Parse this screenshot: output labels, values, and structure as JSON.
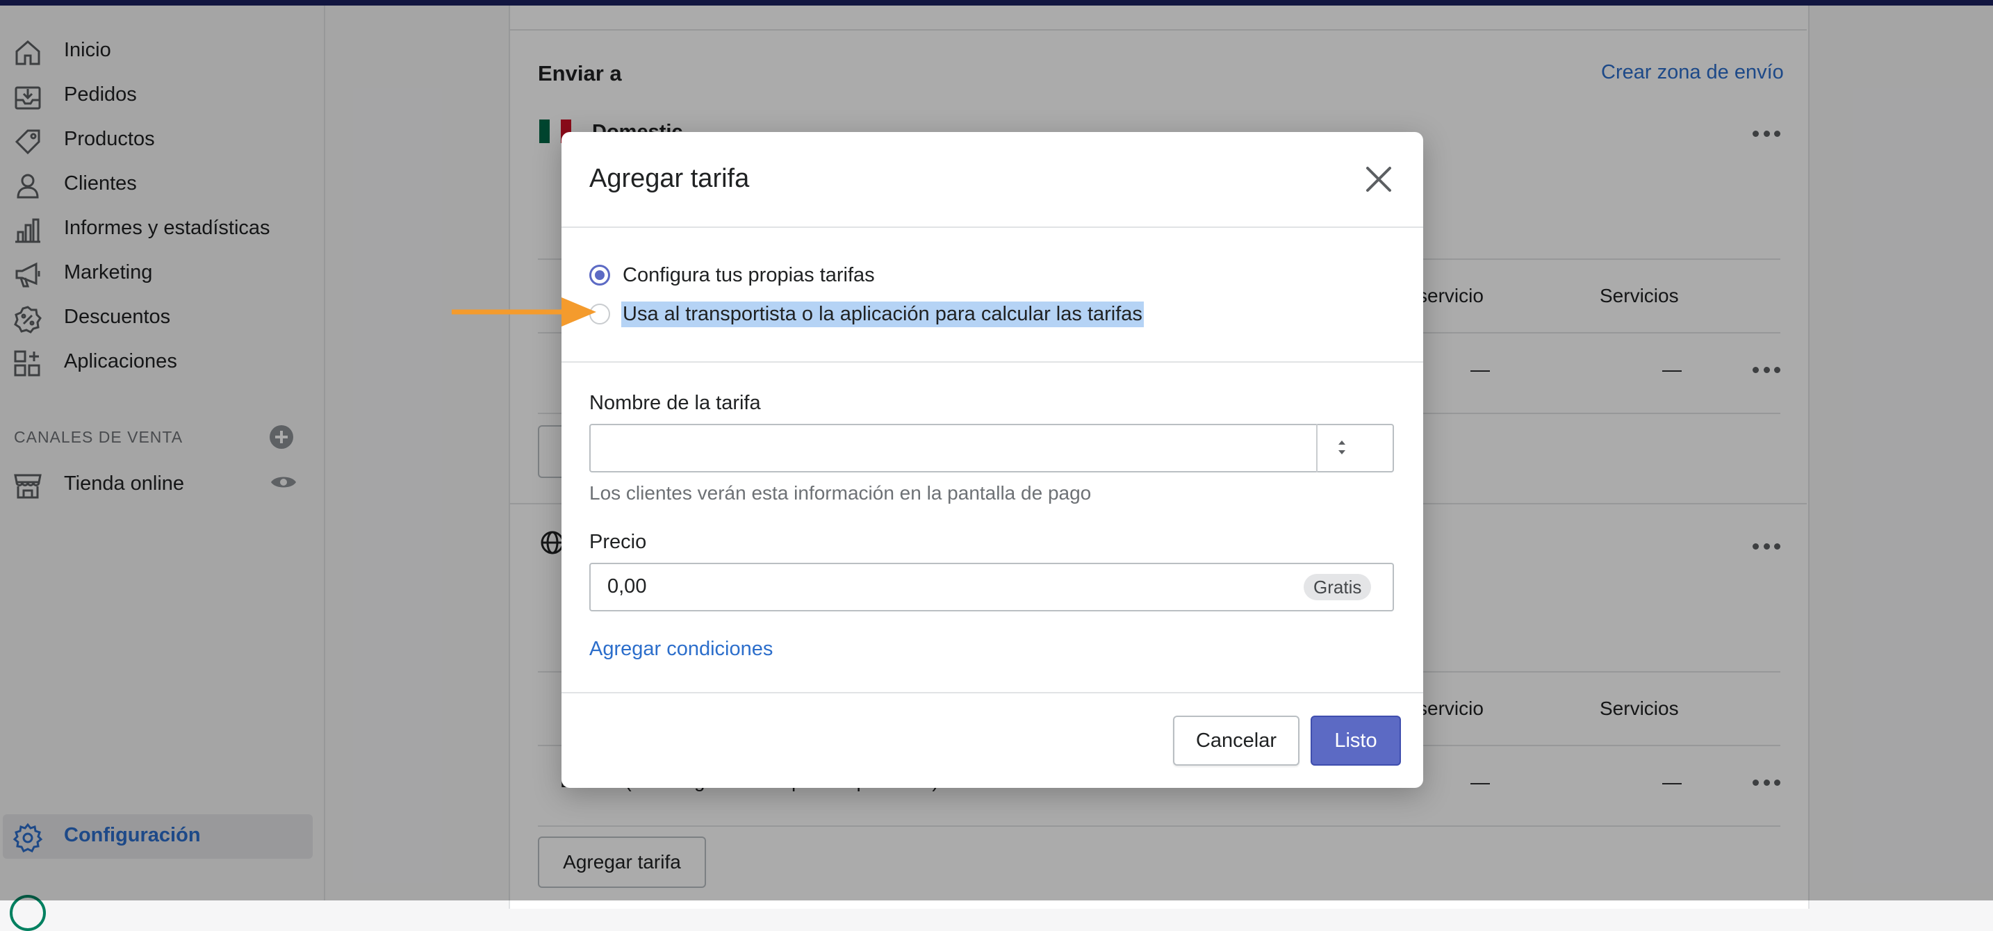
{
  "sidebar": {
    "items": [
      {
        "label": "Inicio",
        "icon": "home-icon"
      },
      {
        "label": "Pedidos",
        "icon": "orders-icon"
      },
      {
        "label": "Productos",
        "icon": "tag-icon"
      },
      {
        "label": "Clientes",
        "icon": "person-icon"
      },
      {
        "label": "Informes y estadísticas",
        "icon": "bar-chart-icon"
      },
      {
        "label": "Marketing",
        "icon": "megaphone-icon"
      },
      {
        "label": "Descuentos",
        "icon": "discount-icon"
      },
      {
        "label": "Aplicaciones",
        "icon": "apps-icon"
      }
    ],
    "sales_channels_title": "CANALES DE VENTA",
    "online_store": "Tienda online",
    "settings": "Configuración"
  },
  "background": {
    "ship_to_title": "Enviar a",
    "create_zone_link": "Crear zona de envío",
    "zone_name": "Domestic",
    "column_service": "servicio",
    "column_services": "Servicios",
    "dash": "—",
    "row_text": "Envíos (Tarifas generadas por la aplicación)",
    "add_rate_button": "Agregar tarifa"
  },
  "modal": {
    "title": "Agregar tarifa",
    "options": [
      {
        "label": "Configura tus propias tarifas",
        "selected": true
      },
      {
        "label": "Usa al transportista o la aplicación para calcular las tarifas",
        "selected": false
      }
    ],
    "rate_name_label": "Nombre de la tarifa",
    "rate_name_value": "",
    "rate_name_help": "Los clientes verán esta información en la pantalla de pago",
    "price_label": "Precio",
    "price_value": "0,00",
    "price_badge": "Gratis",
    "add_conditions": "Agregar condiciones",
    "cancel": "Cancelar",
    "done": "Listo"
  },
  "colors": {
    "accent": "#5c6ac4",
    "link": "#2c6ecb",
    "arrow": "#f49b2d",
    "highlight": "#b5d3f5"
  }
}
